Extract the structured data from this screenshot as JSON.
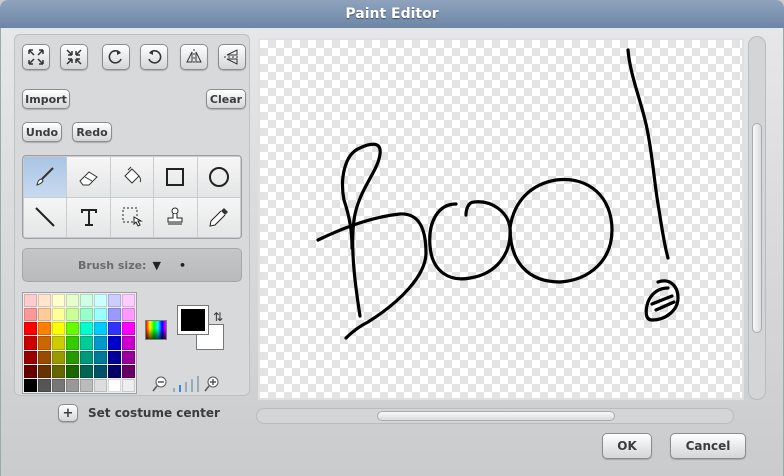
{
  "window": {
    "title": "Paint Editor"
  },
  "toolbar": {
    "buttons": [
      {
        "icon": "grow-icon"
      },
      {
        "icon": "shrink-icon"
      },
      {
        "icon": "rotate-left-icon"
      },
      {
        "icon": "rotate-right-icon"
      },
      {
        "icon": "flip-horizontal-icon"
      },
      {
        "icon": "flip-vertical-icon"
      }
    ],
    "import_label": "Import",
    "clear_label": "Clear",
    "undo_label": "Undo",
    "redo_label": "Redo"
  },
  "tools": {
    "selected": "paintbrush",
    "items": [
      "paintbrush",
      "eraser",
      "fill",
      "rectangle",
      "ellipse",
      "line",
      "text",
      "select",
      "stamp",
      "eyedropper"
    ]
  },
  "brush": {
    "label": "Brush size:",
    "arrow": "▼",
    "dot": "•"
  },
  "colors": {
    "foreground": "#000000",
    "background": "#ffffff",
    "swap_glyph": "⇅",
    "palette": [
      "#ffcccc",
      "#ffe5cc",
      "#ffffcc",
      "#e5ffcc",
      "#ccffe5",
      "#ccffff",
      "#ccccff",
      "#ffccff",
      "#ff9999",
      "#ffcc99",
      "#ffff99",
      "#ccff99",
      "#99ffcc",
      "#99ffff",
      "#9999ff",
      "#ff99ff",
      "#ff0000",
      "#ff8000",
      "#ffff00",
      "#66ff00",
      "#00ffcc",
      "#00ccff",
      "#3333ff",
      "#ff00ff",
      "#cc0000",
      "#cc6600",
      "#cccc00",
      "#33cc00",
      "#00cc99",
      "#0099cc",
      "#0000cc",
      "#cc00cc",
      "#990000",
      "#994c00",
      "#999900",
      "#269900",
      "#00997a",
      "#007a99",
      "#000099",
      "#990099",
      "#660000",
      "#663300",
      "#666600",
      "#196600",
      "#006652",
      "#005266",
      "#000066",
      "#660066",
      "#000000",
      "#555555",
      "#777777",
      "#999999",
      "#bbbbbb",
      "#dddddd",
      "#ffffff",
      "#eeeeee"
    ]
  },
  "center": {
    "plus": "+",
    "label": "Set costume center"
  },
  "footer": {
    "ok_label": "OK",
    "cancel_label": "Cancel"
  }
}
